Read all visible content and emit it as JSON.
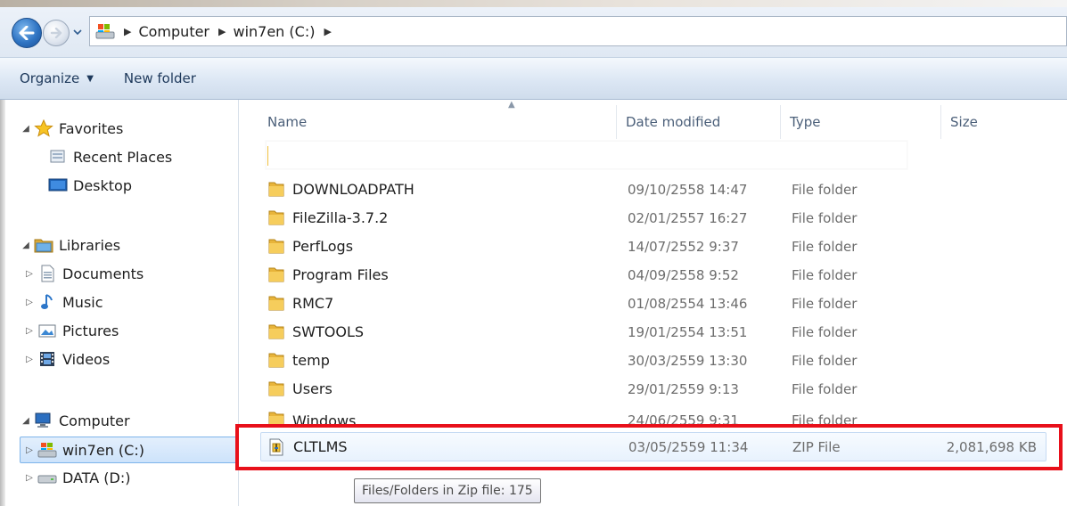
{
  "address": {
    "crumbs": [
      "Computer",
      "win7en (C:)"
    ]
  },
  "toolbar": {
    "organize_label": "Organize",
    "new_folder_label": "New folder"
  },
  "nav": {
    "favorites": "Favorites",
    "recent_places": "Recent Places",
    "desktop": "Desktop",
    "libraries": "Libraries",
    "documents": "Documents",
    "music": "Music",
    "pictures": "Pictures",
    "videos": "Videos",
    "computer": "Computer",
    "win7en": "win7en (C:)",
    "data": "DATA (D:)"
  },
  "columns": {
    "name": "Name",
    "date": "Date modified",
    "type": "Type",
    "size": "Size"
  },
  "files": [
    {
      "name": "DOWNLOADPATH",
      "date": "09/10/2558 14:47",
      "type": "File folder",
      "size": ""
    },
    {
      "name": "FileZilla-3.7.2",
      "date": "02/01/2557 16:27",
      "type": "File folder",
      "size": ""
    },
    {
      "name": "PerfLogs",
      "date": "14/07/2552 9:37",
      "type": "File folder",
      "size": ""
    },
    {
      "name": "Program Files",
      "date": "04/09/2558 9:52",
      "type": "File folder",
      "size": ""
    },
    {
      "name": "RMC7",
      "date": "01/08/2554 13:46",
      "type": "File folder",
      "size": ""
    },
    {
      "name": "SWTOOLS",
      "date": "19/01/2554 13:51",
      "type": "File folder",
      "size": ""
    },
    {
      "name": "temp",
      "date": "30/03/2559 13:30",
      "type": "File folder",
      "size": ""
    },
    {
      "name": "Users",
      "date": "29/01/2559 9:13",
      "type": "File folder",
      "size": ""
    },
    {
      "name": "Windows",
      "date": "24/06/2559 9:31",
      "type": "File folder",
      "size": ""
    },
    {
      "name": "CLTLMS",
      "date": "03/05/2559 11:34",
      "type": "ZIP File",
      "size": "2,081,698 KB"
    }
  ],
  "tooltip": "Files/Folders in Zip file: 175",
  "colors": {
    "highlight_border": "#e8101a",
    "folder": "#e8b43a"
  }
}
